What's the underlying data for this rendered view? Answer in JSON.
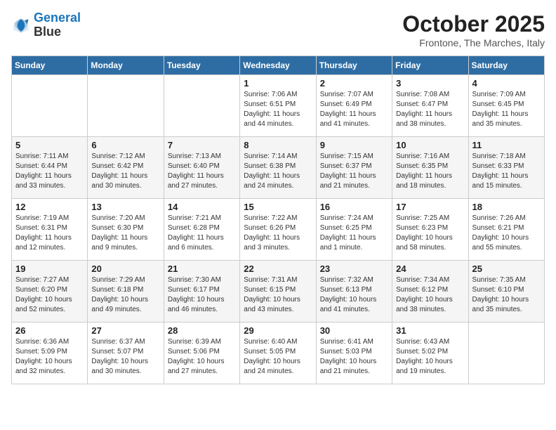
{
  "header": {
    "logo_line1": "General",
    "logo_line2": "Blue",
    "month": "October 2025",
    "location": "Frontone, The Marches, Italy"
  },
  "days_of_week": [
    "Sunday",
    "Monday",
    "Tuesday",
    "Wednesday",
    "Thursday",
    "Friday",
    "Saturday"
  ],
  "weeks": [
    [
      {
        "day": "",
        "info": ""
      },
      {
        "day": "",
        "info": ""
      },
      {
        "day": "",
        "info": ""
      },
      {
        "day": "1",
        "info": "Sunrise: 7:06 AM\nSunset: 6:51 PM\nDaylight: 11 hours\nand 44 minutes."
      },
      {
        "day": "2",
        "info": "Sunrise: 7:07 AM\nSunset: 6:49 PM\nDaylight: 11 hours\nand 41 minutes."
      },
      {
        "day": "3",
        "info": "Sunrise: 7:08 AM\nSunset: 6:47 PM\nDaylight: 11 hours\nand 38 minutes."
      },
      {
        "day": "4",
        "info": "Sunrise: 7:09 AM\nSunset: 6:45 PM\nDaylight: 11 hours\nand 35 minutes."
      }
    ],
    [
      {
        "day": "5",
        "info": "Sunrise: 7:11 AM\nSunset: 6:44 PM\nDaylight: 11 hours\nand 33 minutes."
      },
      {
        "day": "6",
        "info": "Sunrise: 7:12 AM\nSunset: 6:42 PM\nDaylight: 11 hours\nand 30 minutes."
      },
      {
        "day": "7",
        "info": "Sunrise: 7:13 AM\nSunset: 6:40 PM\nDaylight: 11 hours\nand 27 minutes."
      },
      {
        "day": "8",
        "info": "Sunrise: 7:14 AM\nSunset: 6:38 PM\nDaylight: 11 hours\nand 24 minutes."
      },
      {
        "day": "9",
        "info": "Sunrise: 7:15 AM\nSunset: 6:37 PM\nDaylight: 11 hours\nand 21 minutes."
      },
      {
        "day": "10",
        "info": "Sunrise: 7:16 AM\nSunset: 6:35 PM\nDaylight: 11 hours\nand 18 minutes."
      },
      {
        "day": "11",
        "info": "Sunrise: 7:18 AM\nSunset: 6:33 PM\nDaylight: 11 hours\nand 15 minutes."
      }
    ],
    [
      {
        "day": "12",
        "info": "Sunrise: 7:19 AM\nSunset: 6:31 PM\nDaylight: 11 hours\nand 12 minutes."
      },
      {
        "day": "13",
        "info": "Sunrise: 7:20 AM\nSunset: 6:30 PM\nDaylight: 11 hours\nand 9 minutes."
      },
      {
        "day": "14",
        "info": "Sunrise: 7:21 AM\nSunset: 6:28 PM\nDaylight: 11 hours\nand 6 minutes."
      },
      {
        "day": "15",
        "info": "Sunrise: 7:22 AM\nSunset: 6:26 PM\nDaylight: 11 hours\nand 3 minutes."
      },
      {
        "day": "16",
        "info": "Sunrise: 7:24 AM\nSunset: 6:25 PM\nDaylight: 11 hours\nand 1 minute."
      },
      {
        "day": "17",
        "info": "Sunrise: 7:25 AM\nSunset: 6:23 PM\nDaylight: 10 hours\nand 58 minutes."
      },
      {
        "day": "18",
        "info": "Sunrise: 7:26 AM\nSunset: 6:21 PM\nDaylight: 10 hours\nand 55 minutes."
      }
    ],
    [
      {
        "day": "19",
        "info": "Sunrise: 7:27 AM\nSunset: 6:20 PM\nDaylight: 10 hours\nand 52 minutes."
      },
      {
        "day": "20",
        "info": "Sunrise: 7:29 AM\nSunset: 6:18 PM\nDaylight: 10 hours\nand 49 minutes."
      },
      {
        "day": "21",
        "info": "Sunrise: 7:30 AM\nSunset: 6:17 PM\nDaylight: 10 hours\nand 46 minutes."
      },
      {
        "day": "22",
        "info": "Sunrise: 7:31 AM\nSunset: 6:15 PM\nDaylight: 10 hours\nand 43 minutes."
      },
      {
        "day": "23",
        "info": "Sunrise: 7:32 AM\nSunset: 6:13 PM\nDaylight: 10 hours\nand 41 minutes."
      },
      {
        "day": "24",
        "info": "Sunrise: 7:34 AM\nSunset: 6:12 PM\nDaylight: 10 hours\nand 38 minutes."
      },
      {
        "day": "25",
        "info": "Sunrise: 7:35 AM\nSunset: 6:10 PM\nDaylight: 10 hours\nand 35 minutes."
      }
    ],
    [
      {
        "day": "26",
        "info": "Sunrise: 6:36 AM\nSunset: 5:09 PM\nDaylight: 10 hours\nand 32 minutes."
      },
      {
        "day": "27",
        "info": "Sunrise: 6:37 AM\nSunset: 5:07 PM\nDaylight: 10 hours\nand 30 minutes."
      },
      {
        "day": "28",
        "info": "Sunrise: 6:39 AM\nSunset: 5:06 PM\nDaylight: 10 hours\nand 27 minutes."
      },
      {
        "day": "29",
        "info": "Sunrise: 6:40 AM\nSunset: 5:05 PM\nDaylight: 10 hours\nand 24 minutes."
      },
      {
        "day": "30",
        "info": "Sunrise: 6:41 AM\nSunset: 5:03 PM\nDaylight: 10 hours\nand 21 minutes."
      },
      {
        "day": "31",
        "info": "Sunrise: 6:43 AM\nSunset: 5:02 PM\nDaylight: 10 hours\nand 19 minutes."
      },
      {
        "day": "",
        "info": ""
      }
    ]
  ]
}
